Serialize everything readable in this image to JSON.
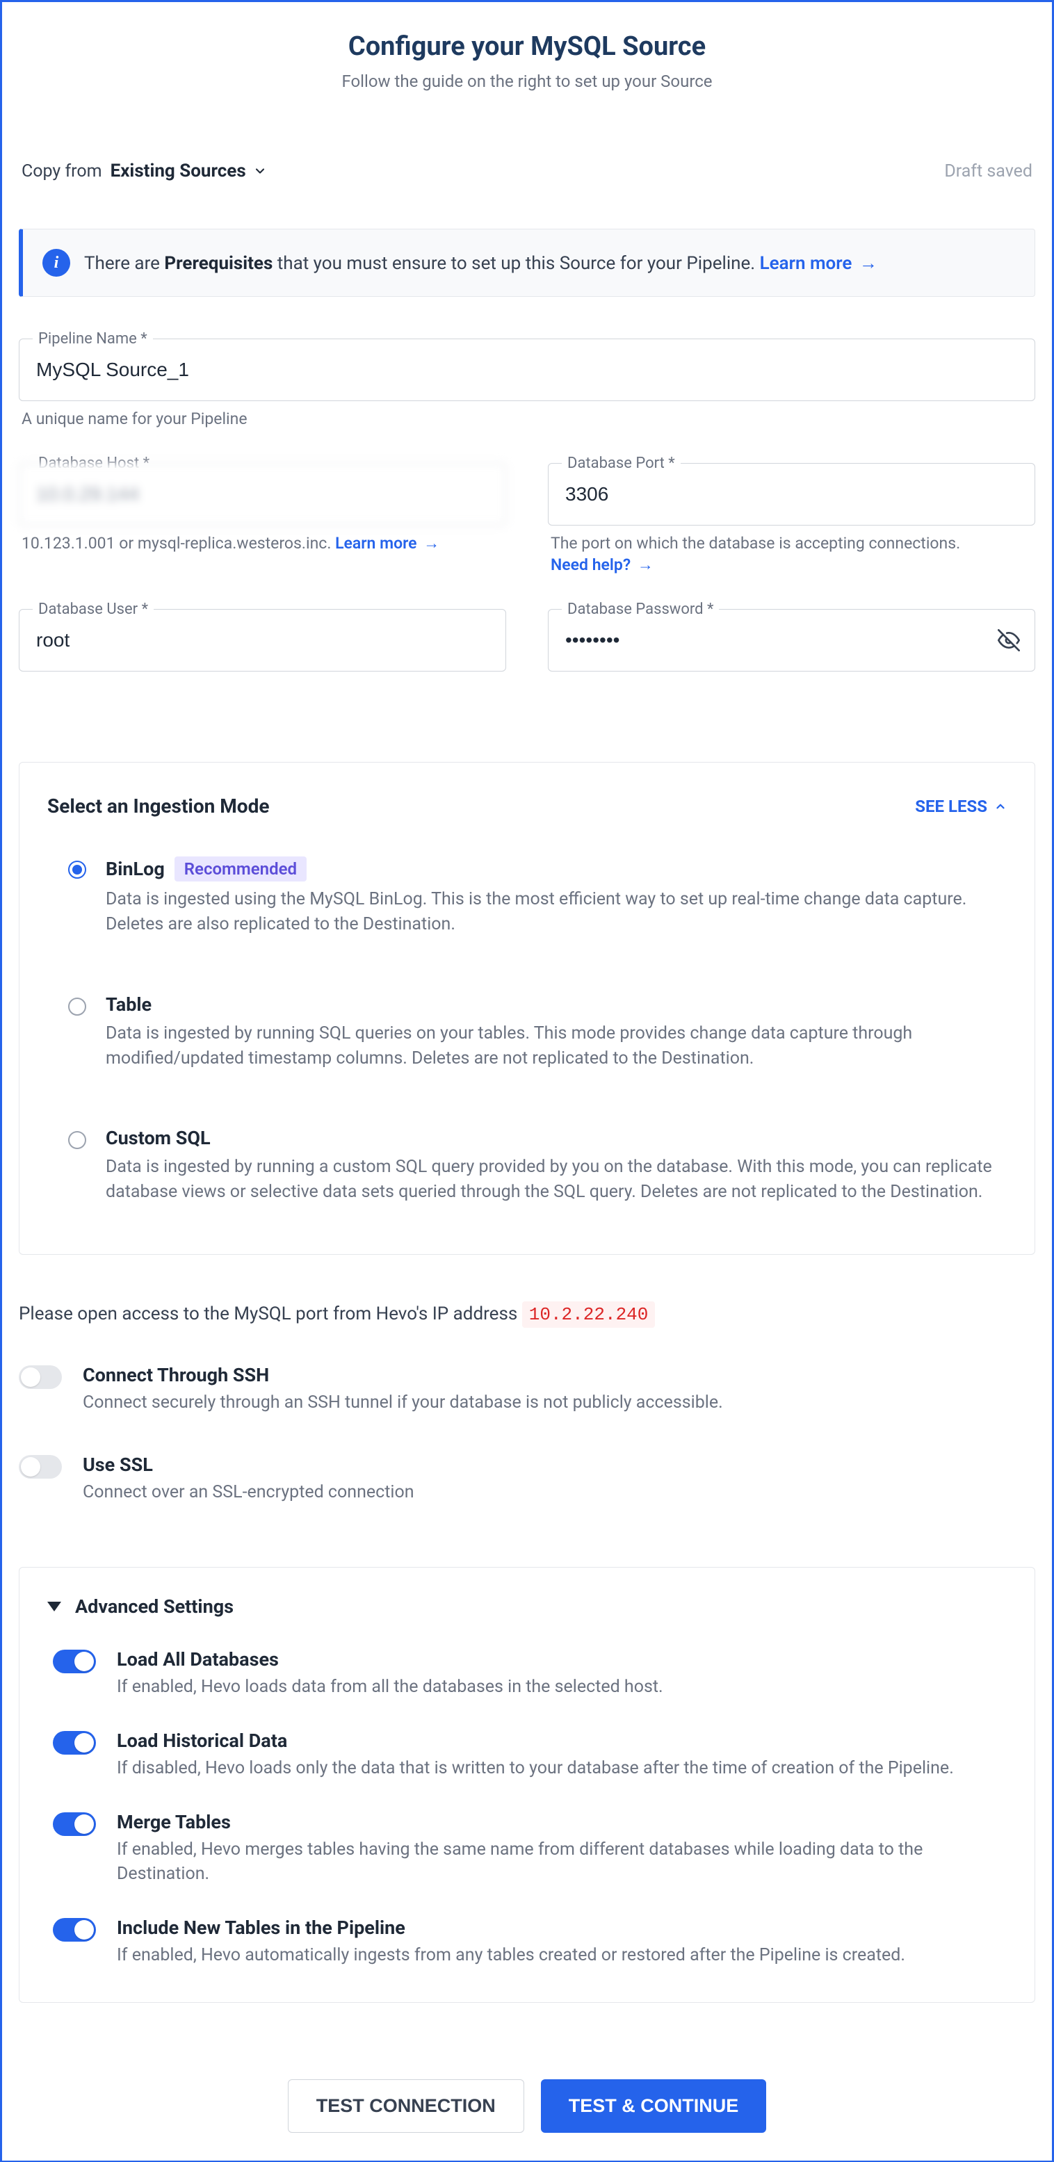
{
  "header": {
    "title": "Configure your MySQL Source",
    "subtitle": "Follow the guide on the right to set up your Source"
  },
  "topRow": {
    "copyFromLabel": "Copy from",
    "copyFromValue": "Existing Sources",
    "draftSaved": "Draft saved"
  },
  "banner": {
    "prefix": "There are ",
    "bold": "Prerequisites",
    "suffix": " that you must ensure to set up this Source for your Pipeline.  ",
    "learnMore": "Learn more"
  },
  "fields": {
    "pipelineName": {
      "label": "Pipeline Name *",
      "value": "MySQL Source_1",
      "help": "A unique name for your Pipeline"
    },
    "host": {
      "label": "Database Host *",
      "value": "10.0.29.144",
      "help": "10.123.1.001 or mysql-replica.westeros.inc. ",
      "learnMore": "Learn more"
    },
    "port": {
      "label": "Database Port *",
      "value": "3306",
      "help": "The port on which the database is accepting connections.",
      "needHelp": "Need help?"
    },
    "user": {
      "label": "Database User *",
      "value": "root"
    },
    "password": {
      "label": "Database Password *",
      "value": "••••••••"
    }
  },
  "ingestion": {
    "title": "Select an Ingestion Mode",
    "seeLess": "SEE LESS",
    "options": [
      {
        "title": "BinLog",
        "recommended": "Recommended",
        "desc": "Data is ingested using the MySQL BinLog. This is the most efficient way to set up real-time change data capture. Deletes are also replicated to the Destination.",
        "selected": true
      },
      {
        "title": "Table",
        "desc": "Data is ingested by running SQL queries on your tables. This mode provides change data capture through modified/updated timestamp columns. Deletes are not replicated to the Destination.",
        "selected": false
      },
      {
        "title": "Custom SQL",
        "desc": "Data is ingested by running a custom SQL query provided by you on the database. With this mode, you can replicate database views or selective data sets queried through the SQL query. Deletes are not replicated to the Destination.",
        "selected": false
      }
    ]
  },
  "ipNote": {
    "text": "Please open access to the MySQL port from Hevo's IP address ",
    "ip": "10.2.22.240"
  },
  "toggles": [
    {
      "title": "Connect Through SSH",
      "desc": "Connect securely through an SSH tunnel if your database is not publicly accessible.",
      "on": false
    },
    {
      "title": "Use SSL",
      "desc": "Connect over an SSL-encrypted connection",
      "on": false
    }
  ],
  "advanced": {
    "title": "Advanced Settings",
    "items": [
      {
        "title": "Load All Databases",
        "desc": "If enabled, Hevo loads data from all the databases in the selected host.",
        "on": true
      },
      {
        "title": "Load Historical Data",
        "desc": "If disabled, Hevo loads only the data that is written to your database after the time of creation of the Pipeline.",
        "on": true
      },
      {
        "title": "Merge Tables",
        "desc": "If enabled, Hevo merges tables having the same name from different databases while loading data to the Destination.",
        "on": true
      },
      {
        "title": "Include New Tables in the Pipeline",
        "desc": "If enabled, Hevo automatically ingests from any tables created or restored after the Pipeline is created.",
        "on": true
      }
    ]
  },
  "footer": {
    "testConnection": "TEST CONNECTION",
    "testContinue": "TEST & CONTINUE"
  }
}
